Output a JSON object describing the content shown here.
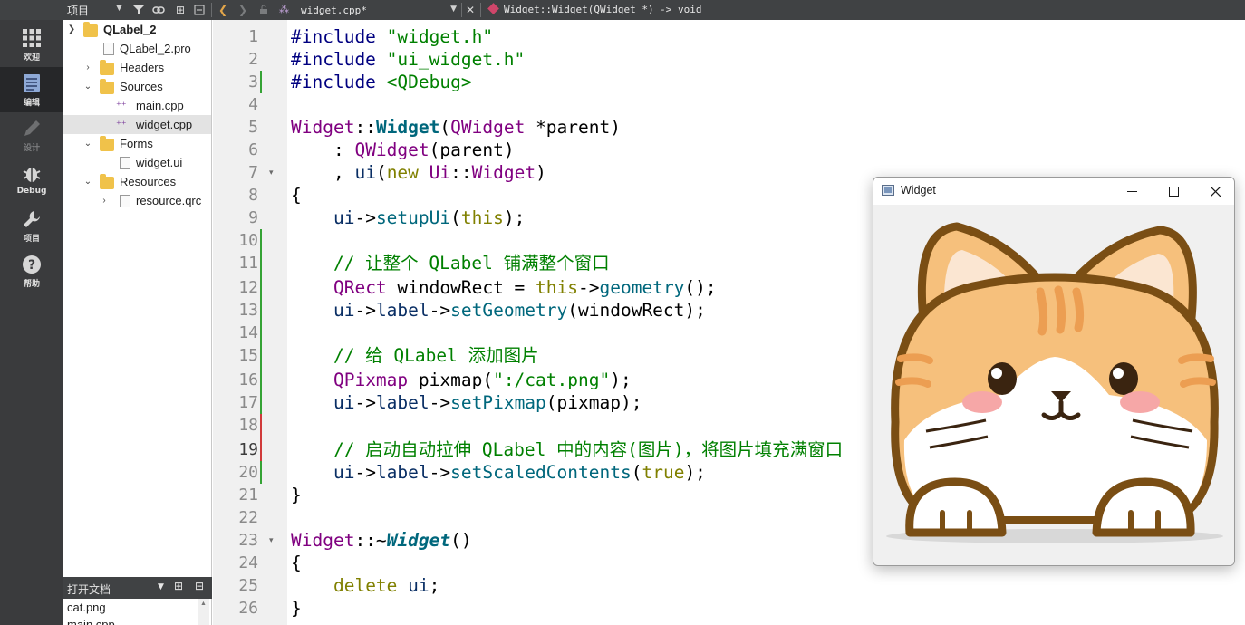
{
  "toolbar": {
    "project_dropdown": "项目",
    "current_file": "widget.cpp*",
    "current_symbol": "Widget::Widget(QWidget *) -> void"
  },
  "modes": [
    {
      "label": "欢迎",
      "icon": "grid-icon"
    },
    {
      "label": "编辑",
      "icon": "edit-doc-icon"
    },
    {
      "label": "设计",
      "icon": "pencil-icon"
    },
    {
      "label": "Debug",
      "icon": "bug-icon"
    },
    {
      "label": "项目",
      "icon": "wrench-icon"
    },
    {
      "label": "帮助",
      "icon": "help-icon"
    }
  ],
  "tree": {
    "items": [
      {
        "label": "QLabel_2",
        "kind": "project"
      },
      {
        "label": "QLabel_2.pro",
        "kind": "file"
      },
      {
        "label": "Headers",
        "kind": "folder"
      },
      {
        "label": "Sources",
        "kind": "folder"
      },
      {
        "label": "main.cpp",
        "kind": "cpp"
      },
      {
        "label": "widget.cpp",
        "kind": "cpp"
      },
      {
        "label": "Forms",
        "kind": "folder"
      },
      {
        "label": "widget.ui",
        "kind": "ui"
      },
      {
        "label": "Resources",
        "kind": "folder"
      },
      {
        "label": "resource.qrc",
        "kind": "qrc"
      }
    ]
  },
  "open_documents": {
    "title": "打开文档",
    "items": [
      "cat.png",
      "main.cpp"
    ]
  },
  "editor": {
    "current_line": 19,
    "lines": [
      "#include \"widget.h\"",
      "#include \"ui_widget.h\"",
      "#include <QDebug>",
      "",
      "Widget::Widget(QWidget *parent)",
      "    : QWidget(parent)",
      "    , ui(new Ui::Widget)",
      "{",
      "    ui->setupUi(this);",
      "",
      "    // 让整个 QLabel 铺满整个窗口",
      "    QRect windowRect = this->geometry();",
      "    ui->label->setGeometry(windowRect);",
      "",
      "    // 给 QLabel 添加图片",
      "    QPixmap pixmap(\":/cat.png\");",
      "    ui->label->setPixmap(pixmap);",
      "",
      "    // 启动自动拉伸 QLabel 中的内容(图片)，将图片填充满窗口",
      "    ui->label->setScaledContents(true);",
      "}",
      "",
      "Widget::~Widget()",
      "{",
      "    delete ui;",
      "}"
    ]
  },
  "widget_window": {
    "title": "Widget",
    "minimize": "—",
    "maximize": "☐",
    "close": "✕"
  },
  "colors": {
    "toolbar_bg": "#404244",
    "modebar_bg": "#3a3b3d",
    "keyword": "#808000",
    "type": "#800080",
    "function": "#00677c",
    "string_comment": "#008000"
  }
}
